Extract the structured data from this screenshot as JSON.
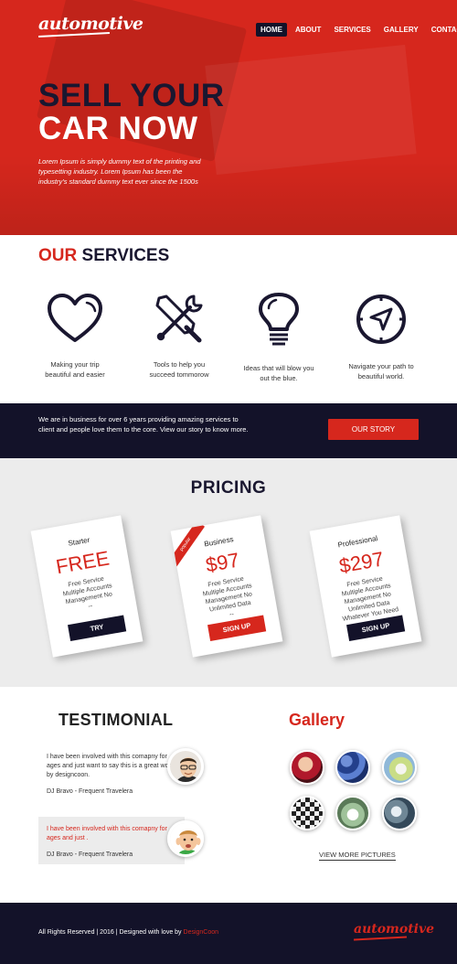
{
  "brand": {
    "logo": "automotive",
    "red": "#d6271d",
    "navy": "#131229"
  },
  "nav": {
    "items": [
      "HOME",
      "ABOUT",
      "SERVICES",
      "GALLERY",
      "CONTACTS"
    ],
    "active": "HOME"
  },
  "hero": {
    "title_line1": "SELL YOUR",
    "title_line2": "CAR NOW",
    "text": "Lorem Ipsum is simply dummy text of the printing and typesetting industry. Lorem Ipsum has been the industry's standard dummy text ever since the 1500s"
  },
  "services": {
    "title_red": "OUR",
    "title_rest": "SERVICES",
    "items": [
      {
        "icon": "heart-icon",
        "text": "Making your trip beautiful and easier"
      },
      {
        "icon": "tools-icon",
        "text": "Tools to help you succeed tommorow"
      },
      {
        "icon": "lightbulb-icon",
        "text": "Ideas that will blow you out the blue."
      },
      {
        "icon": "compass-icon",
        "text": "Navigate your path to beautiful world."
      }
    ]
  },
  "story": {
    "text": "We are in business for over 6 years providing amazing services to client and people love them to the core. View our story to know more.",
    "button": "OUR STORY"
  },
  "pricing": {
    "title": "PRICING",
    "plans": [
      {
        "name": "Starter",
        "price": "FREE",
        "features": [
          "Free Service",
          "Multiple Accounts",
          "Management No",
          "--"
        ],
        "button": "TRY"
      },
      {
        "name": "Business",
        "price": "$97",
        "ribbon": "popular",
        "features": [
          "Free Service",
          "Multiple Accounts",
          "Management No",
          "Unlimited Data",
          "--"
        ],
        "button": "SIGN UP"
      },
      {
        "name": "Professional",
        "price": "$297",
        "features": [
          "Free Service",
          "Multiple Accounts",
          "Management No",
          "Unlimited Data",
          "Whatever You Need"
        ],
        "button": "SIGN UP"
      }
    ]
  },
  "testimonial": {
    "title": "TESTIMONIAL",
    "quotes": [
      {
        "text": "I have been involved with this comapny for ages and just want to say this is a great work by designcoon.",
        "author": "DJ Bravo - Frequent Travelera"
      },
      {
        "text": "I have been involved with this comapny for ages and just .",
        "author": "DJ Bravo - Frequent Travelera"
      }
    ]
  },
  "gallery": {
    "title": "Gallery",
    "more": "VIEW MORE PICTURES"
  },
  "footer": {
    "copy": "All Rights Reserved | 2016 | Designed with love by",
    "credit": "DesignCoon",
    "logo": "automotive"
  }
}
